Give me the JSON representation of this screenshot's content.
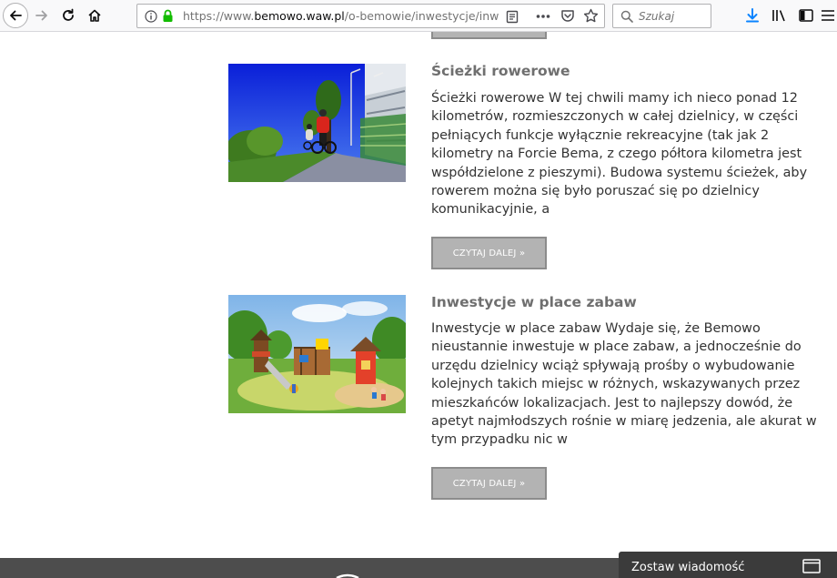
{
  "browser": {
    "url_prefix": "https://www.",
    "url_host": "bemowo.waw.pl",
    "url_path": "/o-bemowie/inwestycje/inwe",
    "search_placeholder": "Szukaj"
  },
  "articles": [
    {
      "title": "Ścieżki rowerowe",
      "excerpt": "Ścieżki rowerowe W tej chwili mamy ich nieco ponad 12 kilometrów, rozmieszczonych w całej dzielnicy, w części pełniących funkcje wyłącznie rekreacyjne (tak jak 2 kilometry na Forcie Bema, z czego półtora kilometra jest współdzielone z pieszymi). Budowa systemu ścieżek, aby rowerem można się było poruszać się po dzielnicy komunikacyjnie, a",
      "read_more": "CZYTAJ DALEJ »"
    },
    {
      "title": "Inwestycje w place zabaw",
      "excerpt": "Inwestycje w place zabaw Wydaje się, że Bemowo nieustannie inwestuje w place zabaw, a jednocześnie do urzędu dzielnicy wciąż spływają prośby o wybudowanie kolejnych takich miejsc w różnych, wskazywanych przez mieszkańców lokalizacjach. Jest to najlepszy dowód, że apetyt najmłodszych rośnie w miarę jedzenia, ale akurat w tym przypadku nic w",
      "read_more": "CZYTAJ DALEJ »"
    }
  ],
  "chat": {
    "label": "Zostaw wiadomość"
  }
}
